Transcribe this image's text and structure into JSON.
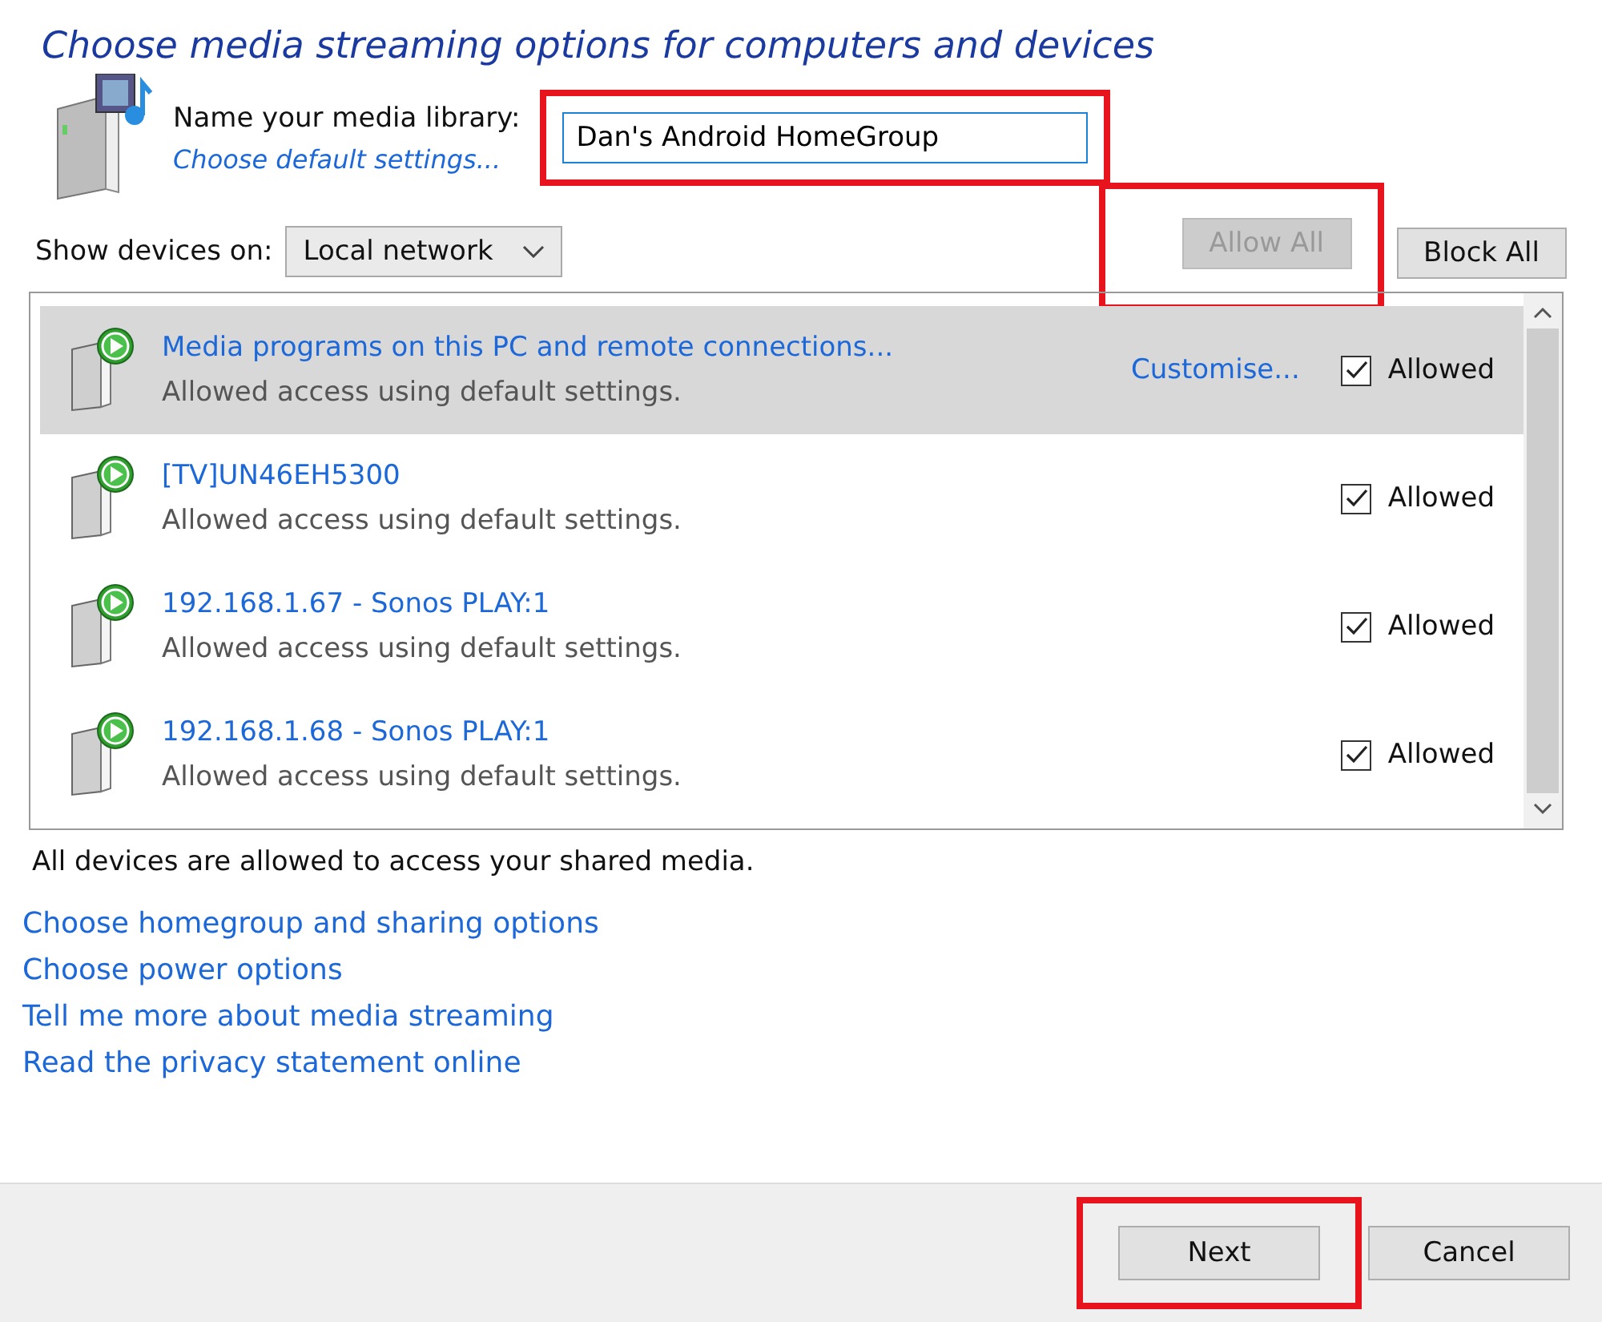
{
  "title": "Choose media streaming options for computers and devices",
  "library": {
    "label": "Name your media library:",
    "value": "Dan's Android HomeGroup",
    "highlighted": true,
    "link": "Choose default settings..."
  },
  "show_devices": {
    "label": "Show devices on:",
    "value": "Local network"
  },
  "buttons_top": [
    {
      "label": "Allow All",
      "disabled": true,
      "highlighted": true
    },
    {
      "label": "Block All",
      "disabled": false,
      "highlighted": false
    }
  ],
  "devices": [
    {
      "name": "Media programs on this PC and remote connections...",
      "status": "Allowed access using default settings.",
      "customise": "Customise...",
      "selected": true,
      "checked": true,
      "check_label": "Allowed"
    },
    {
      "name": "[TV]UN46EH5300",
      "status": "Allowed access using default settings.",
      "selected": false,
      "checked": true,
      "check_label": "Allowed"
    },
    {
      "name": "192.168.1.67 - Sonos PLAY:1",
      "status": "Allowed access using default settings.",
      "selected": false,
      "checked": true,
      "check_label": "Allowed"
    },
    {
      "name": "192.168.1.68 - Sonos PLAY:1",
      "status": "Allowed access using default settings.",
      "selected": false,
      "checked": true,
      "check_label": "Allowed"
    }
  ],
  "summary": "All devices are allowed to access your shared media.",
  "links": [
    "Choose homegroup and sharing options",
    "Choose power options",
    "Tell me more about media streaming",
    "Read the privacy statement online"
  ],
  "footer_buttons": [
    {
      "label": "Next",
      "highlighted": true
    },
    {
      "label": "Cancel",
      "highlighted": false
    }
  ]
}
